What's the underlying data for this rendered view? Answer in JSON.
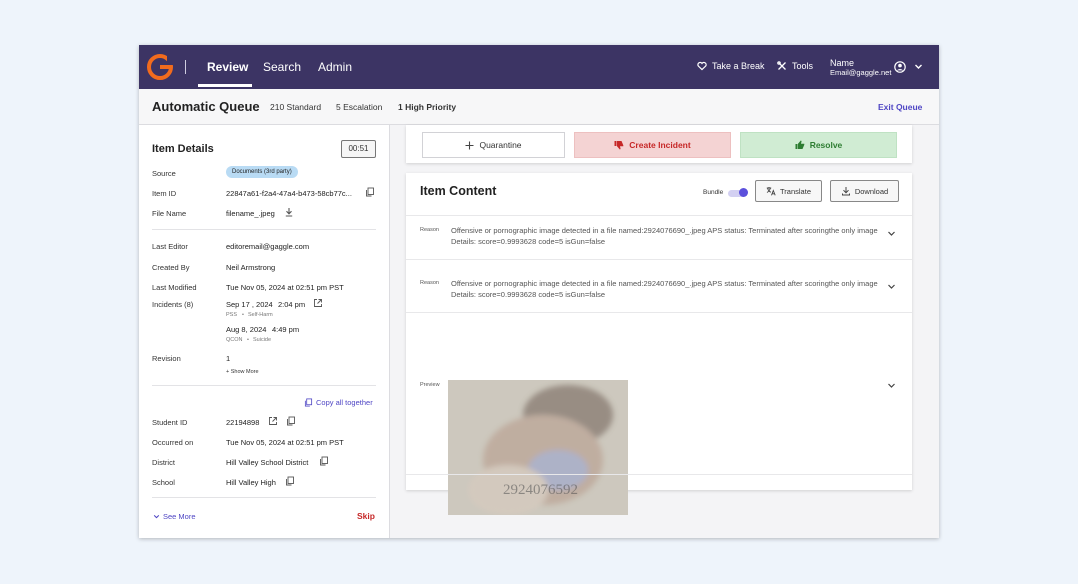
{
  "nav": {
    "tabs": [
      {
        "label": "Review"
      },
      {
        "label": "Search"
      },
      {
        "label": "Admin"
      }
    ],
    "take_break": "Take a Break",
    "tools": "Tools",
    "user_name": "Name",
    "user_email": "Email@gaggle.net",
    "brand_color": "#3c3464"
  },
  "queue": {
    "title": "Automatic Queue",
    "standard": "210 Standard",
    "escalation": "5 Escalation",
    "high_priority": "1 High Priority",
    "exit": "Exit Queue"
  },
  "details": {
    "title": "Item Details",
    "timer": "00:51",
    "source_label": "Source",
    "source_value": "Documents (3rd party)",
    "item_id_label": "Item ID",
    "item_id_value": "22847a61-f2a4-47a4-b473-58cb77c...",
    "file_name_label": "File Name",
    "file_name_value": "filename_.jpeg",
    "last_editor_label": "Last Editor",
    "last_editor_value": "editoremail@gaggle.com",
    "created_by_label": "Created By",
    "created_by_value": "Neil Armstrong",
    "last_modified_label": "Last Modified",
    "last_modified_value": "Tue Nov 05, 2024 at 02:51 pm PST",
    "incidents_label": "Incidents (8)",
    "incidents": [
      {
        "date": "Sep 17 , 2024",
        "time": "2:04 pm",
        "code": "PSS",
        "category": "Self-Harm"
      },
      {
        "date": "Aug 8, 2024",
        "time": "4:49 pm",
        "code": "QCON",
        "category": "Suicide"
      }
    ],
    "revision_label": "Revision",
    "revision_value": "1",
    "show_more": "+ Show More",
    "copy_all": "Copy all together",
    "student_id_label": "Student ID",
    "student_id_value": "22194898",
    "occurred_on_label": "Occurred on",
    "occurred_on_value": "Tue Nov 05, 2024 at 02:51 pm PST",
    "district_label": "District",
    "district_value": "Hill Valley School District",
    "school_label": "School",
    "school_value": "Hill Valley High",
    "see_more": "See More",
    "skip": "Skip"
  },
  "actions": {
    "quarantine": "Quarantine",
    "create_incident": "Create Incident",
    "resolve": "Resolve"
  },
  "content": {
    "title": "Item Content",
    "bundle_label": "Bundle",
    "translate": "Translate",
    "download": "Download",
    "reasons": [
      {
        "label": "Reason",
        "text": "Offensive or pornographic image detected in a file named:2924076690_.jpeg APS status: Terminated after scoringthe only image Details: score=0.9993628 code=5 isGun=false"
      },
      {
        "label": "Reason",
        "text": "Offensive or pornographic image detected in a file named:2924076690_.jpeg APS status: Terminated after scoringthe only image Details: score=0.9993628 code=5 isGun=false"
      }
    ],
    "preview_label": "Preview",
    "preview_watermark": "2924076592"
  }
}
